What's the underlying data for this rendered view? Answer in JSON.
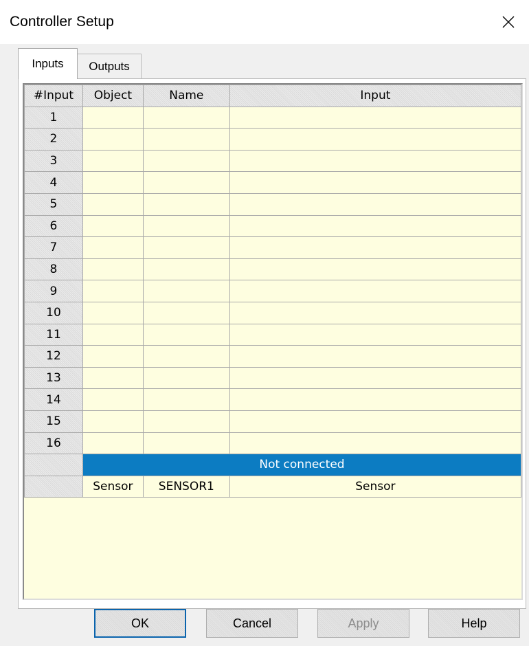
{
  "window": {
    "title": "Controller Setup"
  },
  "tabs": [
    {
      "label": "Inputs"
    },
    {
      "label": "Outputs"
    }
  ],
  "grid": {
    "headers": [
      "#Input",
      "Object",
      "Name",
      "Input"
    ],
    "rows": [
      "1",
      "2",
      "3",
      "4",
      "5",
      "6",
      "7",
      "8",
      "9",
      "10",
      "11",
      "12",
      "13",
      "14",
      "15",
      "16"
    ],
    "status_text": "Not connected",
    "sensor_row": {
      "object": "Sensor",
      "name": "SENSOR1",
      "input": "Sensor"
    }
  },
  "buttons": {
    "ok": "OK",
    "cancel": "Cancel",
    "apply": "Apply",
    "help": "Help"
  },
  "colors": {
    "grid_background": "#fefee0",
    "status_bar": "#0c7cc2",
    "default_button_border": "#0a64ad"
  }
}
